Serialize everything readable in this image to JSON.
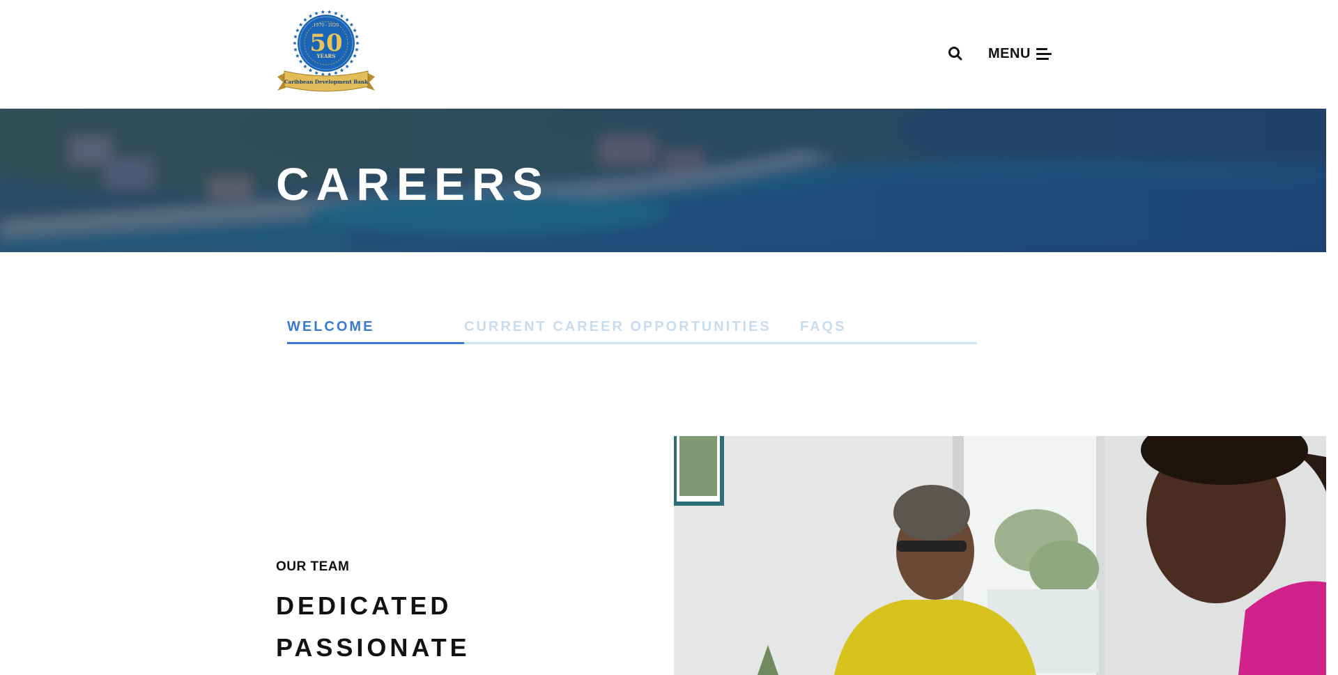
{
  "header": {
    "logo": {
      "years_range": "1970 - 2020",
      "number": "50",
      "years_label": "YEARS",
      "ribbon_text": "Caribbean Development Bank",
      "colors": {
        "badge": "#1a64b5",
        "gold": "#d5ae4b",
        "ribbon": "#e2bd5a"
      }
    },
    "search_icon": "search-icon",
    "menu_label": "MENU",
    "menu_icon": "hamburger-icon"
  },
  "hero": {
    "title": "CAREERS"
  },
  "tabs": [
    {
      "label": "WELCOME",
      "active": true
    },
    {
      "label": "CURRENT CAREER OPPORTUNITIES",
      "active": false
    },
    {
      "label": "FAQS",
      "active": false
    }
  ],
  "team": {
    "eyebrow": "OUR TEAM",
    "lines": [
      "DEDICATED",
      "PASSIONATE"
    ]
  },
  "colors": {
    "accent": "#3b78cf",
    "tab_inactive": "#c7dcef",
    "hero_overlay": "#1d3f72"
  }
}
